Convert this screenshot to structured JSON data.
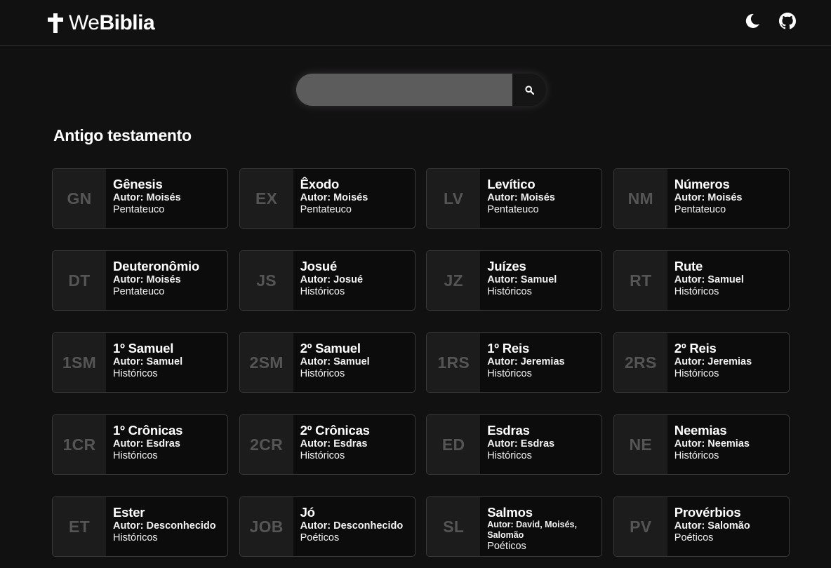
{
  "brand": {
    "we": "We",
    "biblia": "Biblia"
  },
  "header_icons": [
    "cross-icon",
    "moon-icon",
    "github-icon",
    "search-icon"
  ],
  "search": {
    "placeholder": ""
  },
  "section": {
    "title": "Antigo testamento"
  },
  "books": [
    {
      "abbr": "GN",
      "name": "Gênesis",
      "author": "Autor: Moisés",
      "group": "Pentateuco"
    },
    {
      "abbr": "EX",
      "name": "Êxodo",
      "author": "Autor: Moisés",
      "group": "Pentateuco"
    },
    {
      "abbr": "LV",
      "name": "Levítico",
      "author": "Autor: Moisés",
      "group": "Pentateuco"
    },
    {
      "abbr": "NM",
      "name": "Números",
      "author": "Autor: Moisés",
      "group": "Pentateuco"
    },
    {
      "abbr": "DT",
      "name": "Deuteronômio",
      "author": "Autor: Moisés",
      "group": "Pentateuco"
    },
    {
      "abbr": "JS",
      "name": "Josué",
      "author": "Autor: Josué",
      "group": "Históricos"
    },
    {
      "abbr": "JZ",
      "name": "Juízes",
      "author": "Autor: Samuel",
      "group": "Históricos"
    },
    {
      "abbr": "RT",
      "name": "Rute",
      "author": "Autor: Samuel",
      "group": "Históricos"
    },
    {
      "abbr": "1SM",
      "name": "1º Samuel",
      "author": "Autor: Samuel",
      "group": "Históricos"
    },
    {
      "abbr": "2SM",
      "name": "2º Samuel",
      "author": "Autor: Samuel",
      "group": "Históricos"
    },
    {
      "abbr": "1RS",
      "name": "1º Reis",
      "author": "Autor: Jeremias",
      "group": "Históricos"
    },
    {
      "abbr": "2RS",
      "name": "2º Reis",
      "author": "Autor: Jeremias",
      "group": "Históricos"
    },
    {
      "abbr": "1CR",
      "name": "1º Crônicas",
      "author": "Autor: Esdras",
      "group": "Históricos"
    },
    {
      "abbr": "2CR",
      "name": "2º Crônicas",
      "author": "Autor: Esdras",
      "group": "Históricos"
    },
    {
      "abbr": "ED",
      "name": "Esdras",
      "author": "Autor: Esdras",
      "group": "Históricos"
    },
    {
      "abbr": "NE",
      "name": "Neemias",
      "author": "Autor: Neemias",
      "group": "Históricos"
    },
    {
      "abbr": "ET",
      "name": "Ester",
      "author": "Autor: Desconhecido",
      "group": "Históricos"
    },
    {
      "abbr": "JOB",
      "name": "Jó",
      "author": "Autor: Desconhecido",
      "group": "Poéticos"
    },
    {
      "abbr": "SL",
      "name": "Salmos",
      "author": "Autor: David, Moisés, Salomão",
      "group": "Poéticos",
      "small_author": true
    },
    {
      "abbr": "PV",
      "name": "Provérbios",
      "author": "Autor: Salomão",
      "group": "Poéticos"
    }
  ],
  "colors": {
    "background": "#121112",
    "card_background": "#0c0c0c",
    "abbr_background": "#1c1c1c",
    "abbr_text": "#555555",
    "search_input": "#5c5c5c",
    "border": "#3a3a3a"
  }
}
